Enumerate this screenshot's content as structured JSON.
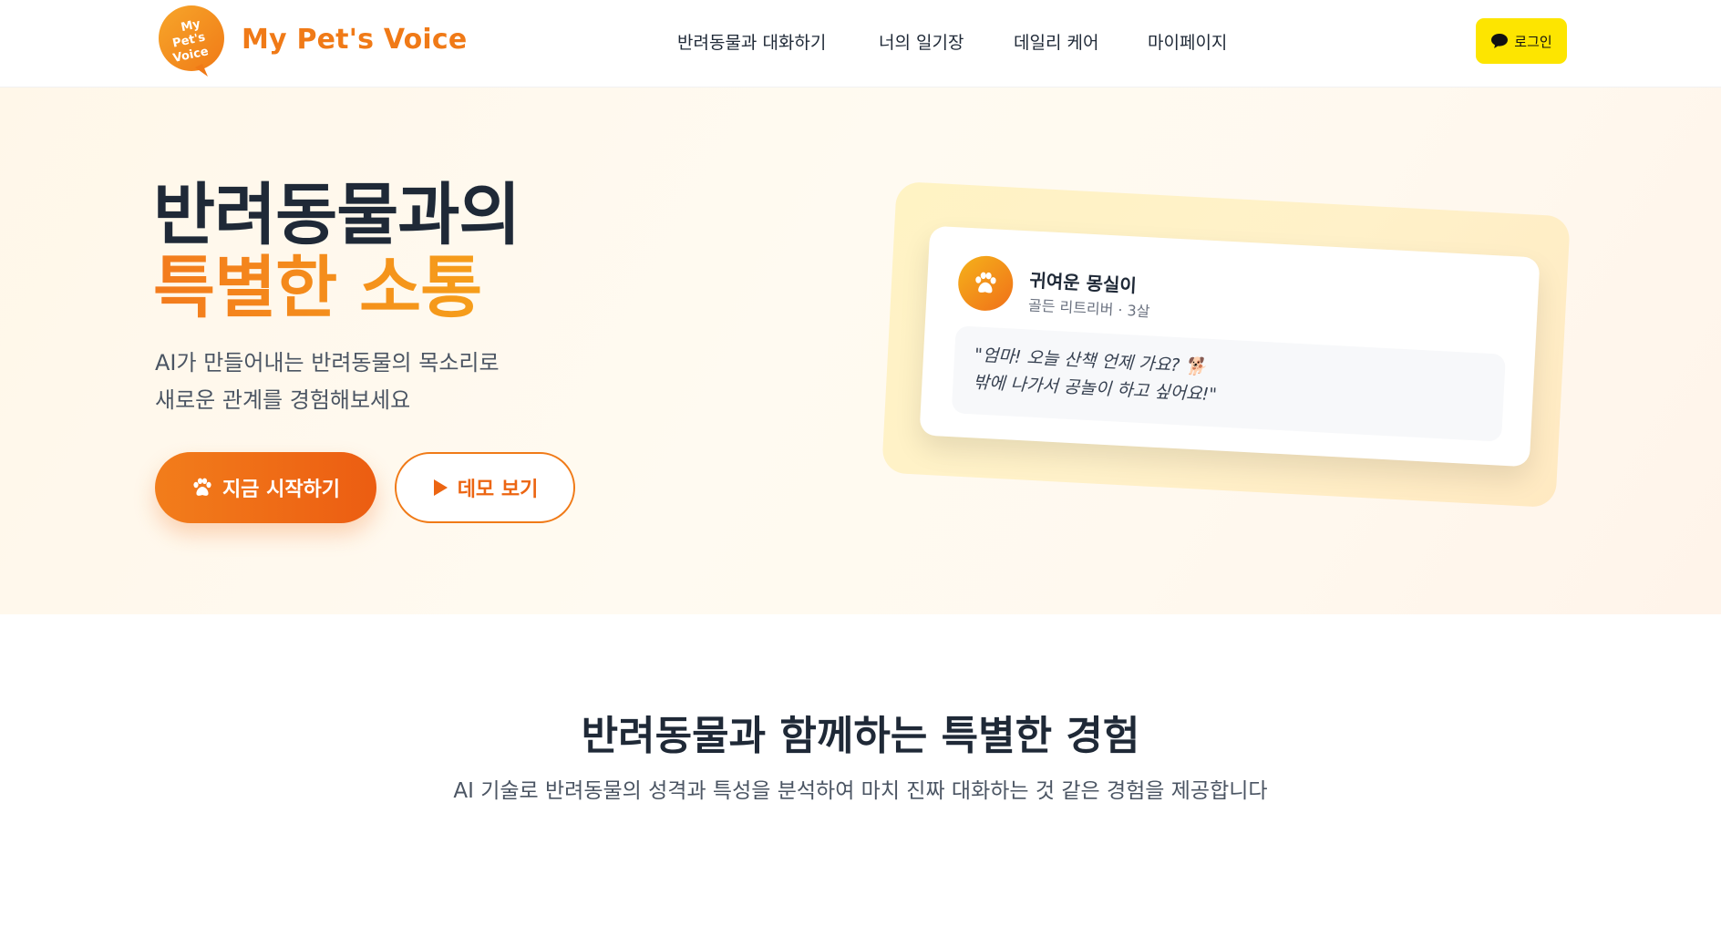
{
  "header": {
    "logo_text": "My Pet's Voice",
    "brand": "My Pet's Voice",
    "nav": [
      {
        "label": "반려동물과 대화하기"
      },
      {
        "label": "너의 일기장"
      },
      {
        "label": "데일리 케어"
      },
      {
        "label": "마이페이지"
      }
    ],
    "login_label": "로그인"
  },
  "hero": {
    "title_line1": "반려동물과의",
    "title_line2": "특별한 소통",
    "subtitle_line1": "AI가 만들어내는 반려동물의 목소리로",
    "subtitle_line2": "새로운 관계를 경험해보세요",
    "primary_button": "지금 시작하기",
    "secondary_button": "데모 보기",
    "card": {
      "pet_name": "귀여운 몽실이",
      "pet_meta": "골든 리트리버 · 3살",
      "message_line1": "\"엄마! 오늘 산책 언제 가요? 🐕",
      "message_line2": "밖에 나가서 공놀이 하고 싶어요!\""
    }
  },
  "section": {
    "title": "반려동물과 함께하는 특별한 경험",
    "subtitle": "AI 기술로 반려동물의 성격과 특성을 분석하여 마치 진짜 대화하는 것 같은 경험을 제공합니다"
  },
  "colors": {
    "brand": "#f07a17",
    "kakao_yellow": "#fde500",
    "primary_gradient_start": "#f27d1b",
    "primary_gradient_end": "#ec5d12"
  },
  "icons": {
    "login": "chat-bubble-icon",
    "primary": "paw-icon",
    "secondary": "play-icon",
    "avatar": "paw-icon"
  }
}
